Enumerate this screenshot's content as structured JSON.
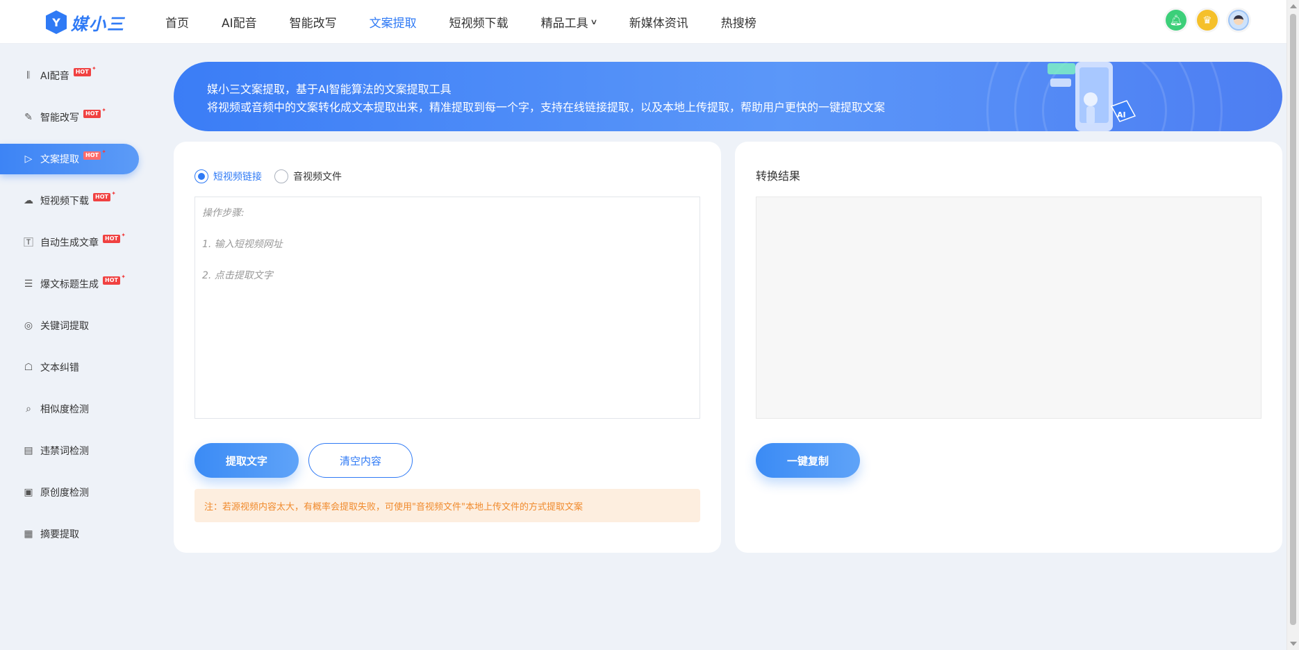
{
  "app": {
    "logo_text": "媒小三"
  },
  "nav": {
    "items": [
      {
        "label": "首页"
      },
      {
        "label": "AI配音"
      },
      {
        "label": "智能改写"
      },
      {
        "label": "文案提取",
        "active": true
      },
      {
        "label": "短视频下载"
      },
      {
        "label": "精品工具",
        "dropdown": true
      },
      {
        "label": "新媒体资讯"
      },
      {
        "label": "热搜榜"
      }
    ]
  },
  "top_icons": [
    "bell-icon",
    "crown-icon",
    "avatar"
  ],
  "sidebar": {
    "items": [
      {
        "label": "AI配音",
        "icon": "audio-wave-icon",
        "hot": "HOT"
      },
      {
        "label": "智能改写",
        "icon": "edit-icon",
        "hot": "HOT"
      },
      {
        "label": "文案提取",
        "icon": "video-play-icon",
        "hot": "HOT",
        "active": true
      },
      {
        "label": "短视频下载",
        "icon": "cloud-download-icon",
        "hot": "HOT"
      },
      {
        "label": "自动生成文章",
        "icon": "text-t-icon",
        "hot": "HOT"
      },
      {
        "label": "爆文标题生成",
        "icon": "title-lines-icon",
        "hot": "HOT"
      },
      {
        "label": "关键词提取",
        "icon": "target-icon"
      },
      {
        "label": "文本纠错",
        "icon": "robot-icon"
      },
      {
        "label": "相似度检测",
        "icon": "magnifier-icon"
      },
      {
        "label": "违禁词检测",
        "icon": "doc-check-icon"
      },
      {
        "label": "原创度检测",
        "icon": "doc-search-icon"
      },
      {
        "label": "摘要提取",
        "icon": "summary-icon"
      }
    ]
  },
  "banner": {
    "title": "媒小三文案提取，基于AI智能算法的文案提取工具",
    "description": "将视频或音频中的文案转化成文本提取出来，精准提取到每一个字，支持在线链接提取，以及本地上传提取，帮助用户更快的一键提取文案"
  },
  "left_panel": {
    "radio_options": [
      {
        "label": "短视频链接",
        "checked": true
      },
      {
        "label": "音视频文件",
        "checked": false
      }
    ],
    "input_placeholder": "操作步骤:\n\n1. 输入短视频网址\n\n2. 点击提取文字",
    "extract_button": "提取文字",
    "clear_button": "清空内容",
    "note": "注：若源视频内容太大，有概率会提取失败，可使用\"音视频文件\"本地上传文件的方式提取文案"
  },
  "right_panel": {
    "title": "转换结果",
    "result_text": "",
    "copy_button": "一键复制"
  },
  "colors": {
    "accent": "#2f7af5",
    "hot_badge": "#f04141",
    "note_bg": "#fdeedf",
    "note_text": "#f08a2c"
  }
}
